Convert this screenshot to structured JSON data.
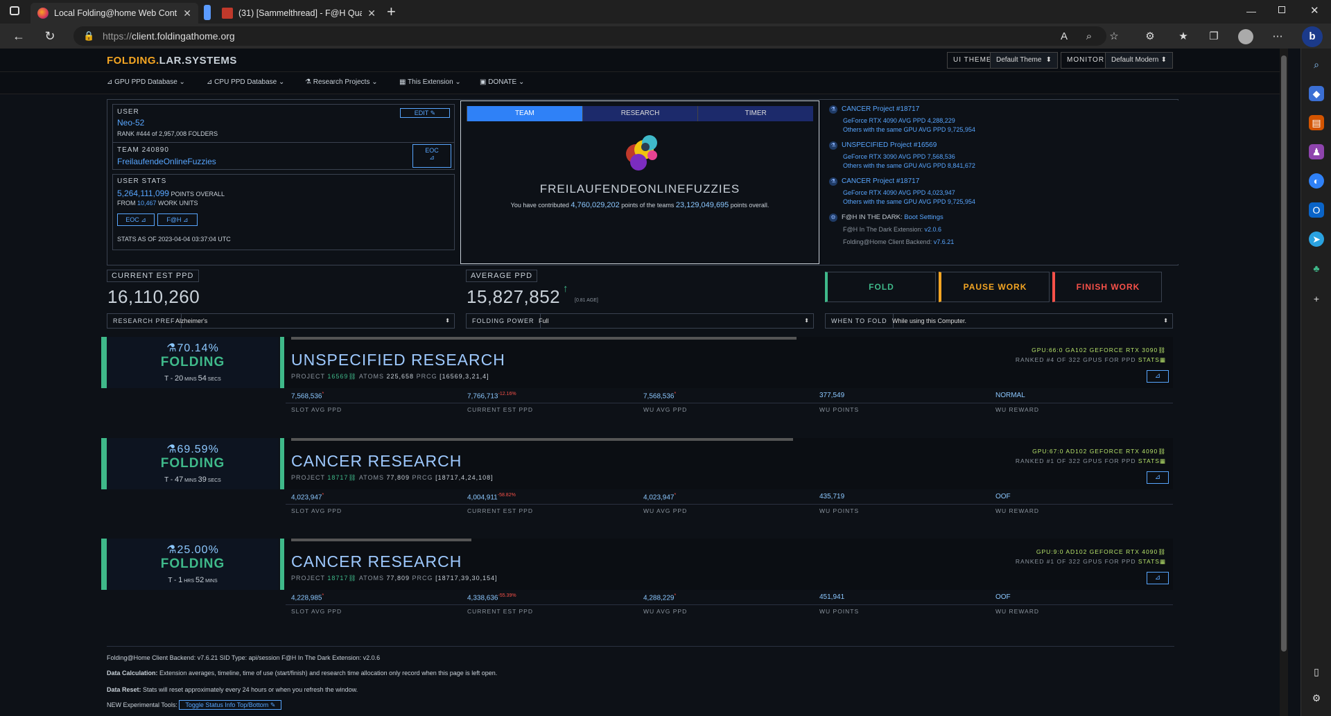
{
  "browser": {
    "tabs": [
      {
        "title": "Local Folding@home Web Contr",
        "active": true
      },
      {
        "title": "(31) [Sammelthread] - F@H Qua",
        "active": false
      }
    ],
    "url_prefix": "https://",
    "url_host": "client.foldingathome.org"
  },
  "app": {
    "brand_a": "FOLDING.",
    "brand_b": "LAR.SYSTEMS",
    "ui_theme_label": "UI THEME",
    "ui_theme_value": "Default Theme",
    "monitor_label": "MONITOR",
    "monitor_value": "Default Modern",
    "nav": [
      "GPU PPD Database",
      "CPU PPD Database",
      "Research Projects",
      "This Extension",
      "DONATE"
    ]
  },
  "user": {
    "label": "USER",
    "edit_label": "EDIT",
    "name": "Neo-52",
    "rank_prefix": "RANK ",
    "rank": "#444",
    "rank_mid": " of ",
    "rank_total": "2,957,008",
    "rank_suffix": " FOLDERS",
    "team_label": "TEAM",
    "team_id": "240890",
    "team_name": "FreilaufendeOnlineFuzzies",
    "eoc_label": "EOC",
    "stats_label": "USER STATS",
    "points": "5,264,111,099",
    "points_suffix": " POINTS OVERALL",
    "from_prefix": "FROM ",
    "work_units": "10,467",
    "wu_suffix": " WORK UNITS",
    "eoc_btn": "EOC",
    "fah_btn": "F@H",
    "stats_asof_prefix": "STATS AS OF ",
    "stats_asof": "2023-04-04 03:37:04",
    "stats_asof_suffix": " UTC"
  },
  "team": {
    "tabs": [
      "TEAM",
      "RESEARCH",
      "TIMER"
    ],
    "name": "FREILAUFENDEONLINEFUZZIES",
    "contrib_a": "You have contributed ",
    "contrib_pts": "4,760,029,202",
    "contrib_b": " points of the teams ",
    "team_pts": "23,129,049,695",
    "contrib_c": " points overall."
  },
  "projects": [
    {
      "title": "CANCER Project #18717",
      "line1": "GeForce RTX 4090 AVG PPD 4,288,229",
      "line2": "Others with the same GPU AVG PPD 9,725,954"
    },
    {
      "title": "UNSPECIFIED Project #16569",
      "line1": "GeForce RTX 3090 AVG PPD 7,568,536",
      "line2": "Others with the same GPU AVG PPD 8,841,672"
    },
    {
      "title": "CANCER Project #18717",
      "line1": "GeForce RTX 4090 AVG PPD 4,023,947",
      "line2": "Others with the same GPU AVG PPD 9,725,954"
    }
  ],
  "darkinfo": {
    "title_a": "F@H IN THE DARK: ",
    "title_b": "Boot Settings",
    "ext_a": "F@H In The Dark Extension: ",
    "ext_v": "v2.0.6",
    "be_a": "Folding@Home Client Backend: ",
    "be_v": "v7.6.21"
  },
  "ppd": {
    "current_label": "CURRENT EST PPD",
    "current_value": "16,110,260",
    "avg_label": "AVERAGE PPD",
    "avg_value": "15,827,852",
    "avg_age": "[0.81 AGE]"
  },
  "buttons": {
    "fold": "FOLD",
    "pause": "PAUSE WORK",
    "finish": "FINISH WORK"
  },
  "settings": {
    "research_label": "RESEARCH PREF",
    "research_value": "Alzheimer's",
    "power_label": "FOLDING POWER",
    "power_value": "Full",
    "when_label": "WHEN TO FOLD",
    "when_value": "While using this Computer."
  },
  "slots": [
    {
      "pct": "70.14%",
      "progress": 0.7014,
      "state": "FOLDING",
      "eta_a": "T - ",
      "eta_n1": "20",
      "eta_u1": " MINS ",
      "eta_n2": "54",
      "eta_u2": " SECS",
      "title": "UNSPECIFIED RESEARCH",
      "project": "16569",
      "atoms": "225,658",
      "prcg": "[16569,3,21,4]",
      "gpu": "GPU:66:0 GA102 GEFORCE RTX 3090",
      "rank_a": "RANKED #4 OF 322 GPUS FOR PPD ",
      "rank_b": "STATS",
      "slot_avg": "7,568,536",
      "slot_avg_sup": "*",
      "cur_est": "7,766,713",
      "cur_est_sup": "-12.16%",
      "wu_avg": "7,568,536",
      "wu_avg_sup": "*",
      "wu_points": "377,549",
      "wu_reward": "NORMAL"
    },
    {
      "pct": "69.59%",
      "progress": 0.6959,
      "state": "FOLDING",
      "eta_a": "T - ",
      "eta_n1": "47",
      "eta_u1": " MINS ",
      "eta_n2": "39",
      "eta_u2": " SECS",
      "title": "CANCER RESEARCH",
      "project": "18717",
      "atoms": "77,809",
      "prcg": "[18717,4,24,108]",
      "gpu": "GPU:67:0 AD102 GEFORCE RTX 4090",
      "rank_a": "RANKED #1 OF 322 GPUS FOR PPD ",
      "rank_b": "STATS",
      "slot_avg": "4,023,947",
      "slot_avg_sup": "*",
      "cur_est": "4,004,911",
      "cur_est_sup": "-58.82%",
      "wu_avg": "4,023,947",
      "wu_avg_sup": "*",
      "wu_points": "435,719",
      "wu_reward": "OOF"
    },
    {
      "pct": "25.00%",
      "progress": 0.25,
      "state": "FOLDING",
      "eta_a": "T - ",
      "eta_n1": "1",
      "eta_u1": " HRS ",
      "eta_n2": "52",
      "eta_u2": " MINS",
      "title": "CANCER RESEARCH",
      "project": "18717",
      "atoms": "77,809",
      "prcg": "[18717,39,30,154]",
      "gpu": "GPU:9:0 AD102 GEFORCE RTX 4090",
      "rank_a": "RANKED #1 OF 322 GPUS FOR PPD ",
      "rank_b": "STATS",
      "slot_avg": "4,228,985",
      "slot_avg_sup": "*",
      "cur_est": "4,338,636",
      "cur_est_sup": "-55.39%",
      "wu_avg": "4,288,229",
      "wu_avg_sup": "*",
      "wu_points": "451,941",
      "wu_reward": "OOF"
    }
  ],
  "cols": [
    "SLOT AVG PPD",
    "CURRENT EST PPD",
    "WU AVG PPD",
    "WU POINTS",
    "WU REWARD"
  ],
  "slot_labels": {
    "project": "PROJECT ",
    "atoms": "ATOMS ",
    "prcg": "PRCG "
  },
  "footer": {
    "line1": "Folding@Home Client Backend: v7.6.21   SID Type: api/session   F@H In The Dark Extension: v2.0.6",
    "dc_label": "Data Calculation:",
    "dc_text": " Extension averages, timeline, time of use (start/finish) and research time allocation only record when this page is left open.",
    "dr_label": "Data Reset:",
    "dr_text": " Stats will reset approximately every 24 hours or when you refresh the window.",
    "tools_label": "NEW Experimental Tools:",
    "tools_btn": "Toggle Status Info Top/Bottom"
  }
}
